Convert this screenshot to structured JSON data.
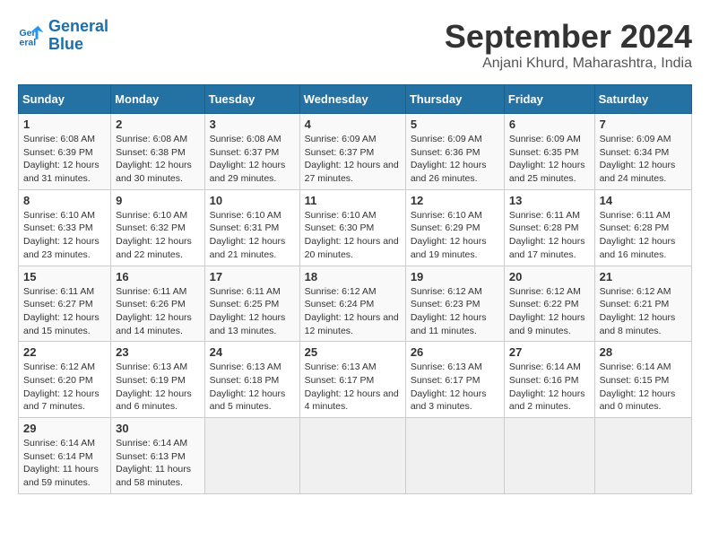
{
  "logo": {
    "line1": "General",
    "line2": "Blue"
  },
  "title": "September 2024",
  "subtitle": "Anjani Khurd, Maharashtra, India",
  "days_header": [
    "Sunday",
    "Monday",
    "Tuesday",
    "Wednesday",
    "Thursday",
    "Friday",
    "Saturday"
  ],
  "weeks": [
    [
      {
        "day": "1",
        "sunrise": "6:08 AM",
        "sunset": "6:39 PM",
        "daylight": "12 hours and 31 minutes."
      },
      {
        "day": "2",
        "sunrise": "6:08 AM",
        "sunset": "6:38 PM",
        "daylight": "12 hours and 30 minutes."
      },
      {
        "day": "3",
        "sunrise": "6:08 AM",
        "sunset": "6:37 PM",
        "daylight": "12 hours and 29 minutes."
      },
      {
        "day": "4",
        "sunrise": "6:09 AM",
        "sunset": "6:37 PM",
        "daylight": "12 hours and 27 minutes."
      },
      {
        "day": "5",
        "sunrise": "6:09 AM",
        "sunset": "6:36 PM",
        "daylight": "12 hours and 26 minutes."
      },
      {
        "day": "6",
        "sunrise": "6:09 AM",
        "sunset": "6:35 PM",
        "daylight": "12 hours and 25 minutes."
      },
      {
        "day": "7",
        "sunrise": "6:09 AM",
        "sunset": "6:34 PM",
        "daylight": "12 hours and 24 minutes."
      }
    ],
    [
      {
        "day": "8",
        "sunrise": "6:10 AM",
        "sunset": "6:33 PM",
        "daylight": "12 hours and 23 minutes."
      },
      {
        "day": "9",
        "sunrise": "6:10 AM",
        "sunset": "6:32 PM",
        "daylight": "12 hours and 22 minutes."
      },
      {
        "day": "10",
        "sunrise": "6:10 AM",
        "sunset": "6:31 PM",
        "daylight": "12 hours and 21 minutes."
      },
      {
        "day": "11",
        "sunrise": "6:10 AM",
        "sunset": "6:30 PM",
        "daylight": "12 hours and 20 minutes."
      },
      {
        "day": "12",
        "sunrise": "6:10 AM",
        "sunset": "6:29 PM",
        "daylight": "12 hours and 19 minutes."
      },
      {
        "day": "13",
        "sunrise": "6:11 AM",
        "sunset": "6:28 PM",
        "daylight": "12 hours and 17 minutes."
      },
      {
        "day": "14",
        "sunrise": "6:11 AM",
        "sunset": "6:28 PM",
        "daylight": "12 hours and 16 minutes."
      }
    ],
    [
      {
        "day": "15",
        "sunrise": "6:11 AM",
        "sunset": "6:27 PM",
        "daylight": "12 hours and 15 minutes."
      },
      {
        "day": "16",
        "sunrise": "6:11 AM",
        "sunset": "6:26 PM",
        "daylight": "12 hours and 14 minutes."
      },
      {
        "day": "17",
        "sunrise": "6:11 AM",
        "sunset": "6:25 PM",
        "daylight": "12 hours and 13 minutes."
      },
      {
        "day": "18",
        "sunrise": "6:12 AM",
        "sunset": "6:24 PM",
        "daylight": "12 hours and 12 minutes."
      },
      {
        "day": "19",
        "sunrise": "6:12 AM",
        "sunset": "6:23 PM",
        "daylight": "12 hours and 11 minutes."
      },
      {
        "day": "20",
        "sunrise": "6:12 AM",
        "sunset": "6:22 PM",
        "daylight": "12 hours and 9 minutes."
      },
      {
        "day": "21",
        "sunrise": "6:12 AM",
        "sunset": "6:21 PM",
        "daylight": "12 hours and 8 minutes."
      }
    ],
    [
      {
        "day": "22",
        "sunrise": "6:12 AM",
        "sunset": "6:20 PM",
        "daylight": "12 hours and 7 minutes."
      },
      {
        "day": "23",
        "sunrise": "6:13 AM",
        "sunset": "6:19 PM",
        "daylight": "12 hours and 6 minutes."
      },
      {
        "day": "24",
        "sunrise": "6:13 AM",
        "sunset": "6:18 PM",
        "daylight": "12 hours and 5 minutes."
      },
      {
        "day": "25",
        "sunrise": "6:13 AM",
        "sunset": "6:17 PM",
        "daylight": "12 hours and 4 minutes."
      },
      {
        "day": "26",
        "sunrise": "6:13 AM",
        "sunset": "6:17 PM",
        "daylight": "12 hours and 3 minutes."
      },
      {
        "day": "27",
        "sunrise": "6:14 AM",
        "sunset": "6:16 PM",
        "daylight": "12 hours and 2 minutes."
      },
      {
        "day": "28",
        "sunrise": "6:14 AM",
        "sunset": "6:15 PM",
        "daylight": "12 hours and 0 minutes."
      }
    ],
    [
      {
        "day": "29",
        "sunrise": "6:14 AM",
        "sunset": "6:14 PM",
        "daylight": "11 hours and 59 minutes."
      },
      {
        "day": "30",
        "sunrise": "6:14 AM",
        "sunset": "6:13 PM",
        "daylight": "11 hours and 58 minutes."
      },
      null,
      null,
      null,
      null,
      null
    ]
  ],
  "labels": {
    "sunrise": "Sunrise: ",
    "sunset": "Sunset: ",
    "daylight": "Daylight: "
  }
}
